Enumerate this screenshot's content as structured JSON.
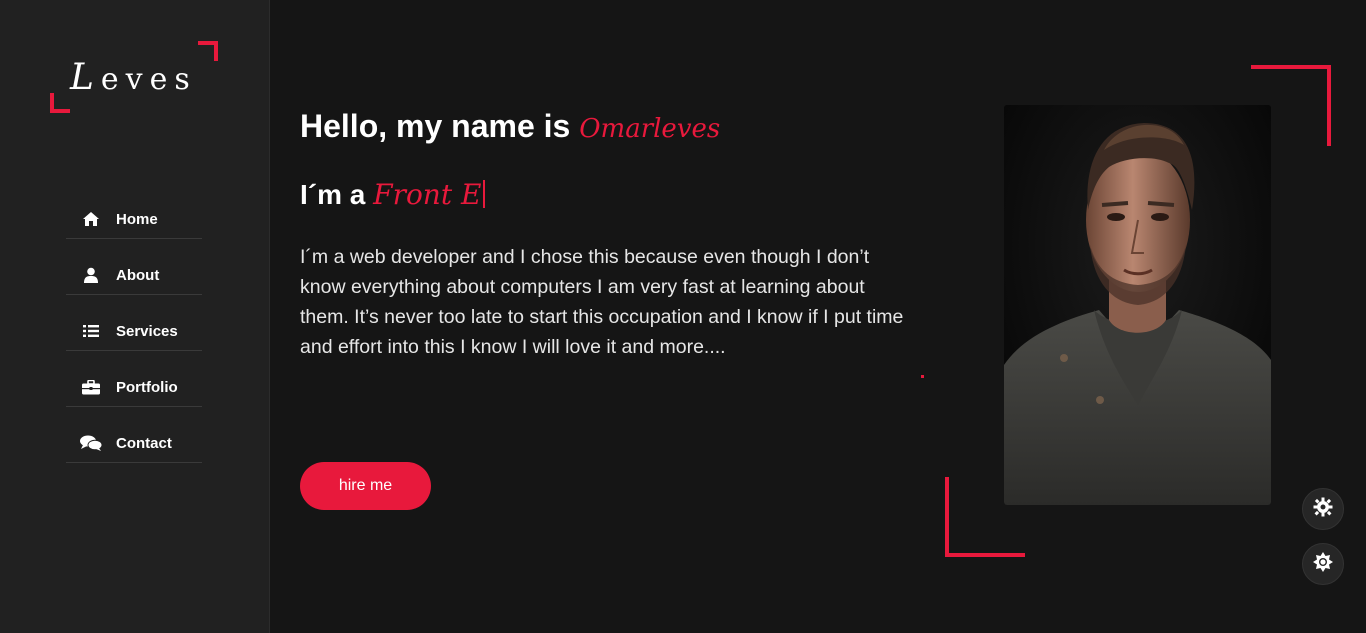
{
  "logo": {
    "cap": "L",
    "rest": "eves"
  },
  "nav": {
    "items": [
      {
        "label": "Home",
        "icon": "home-icon"
      },
      {
        "label": "About",
        "icon": "user-icon"
      },
      {
        "label": "Services",
        "icon": "list-icon"
      },
      {
        "label": "Portfolio",
        "icon": "briefcase-icon"
      },
      {
        "label": "Contact",
        "icon": "comments-icon"
      }
    ]
  },
  "hero": {
    "greeting": "Hello, my name is",
    "name": "Omarleves",
    "iam_prefix": "I´m a",
    "typed_role": "Front E",
    "bio": "I´m a web developer and I chose this because even though I don’t know everything about computers I am very fast at learning about them. It’s never too late to start this occupation and I know if I put time and effort into this I know I will love it and more....",
    "hire_label": "hire me"
  },
  "colors": {
    "accent": "#e8193c",
    "background": "#151515",
    "sidebar": "#212121"
  },
  "floating": {
    "settings_icon": "gear-icon",
    "theme_icon": "sun-icon"
  }
}
